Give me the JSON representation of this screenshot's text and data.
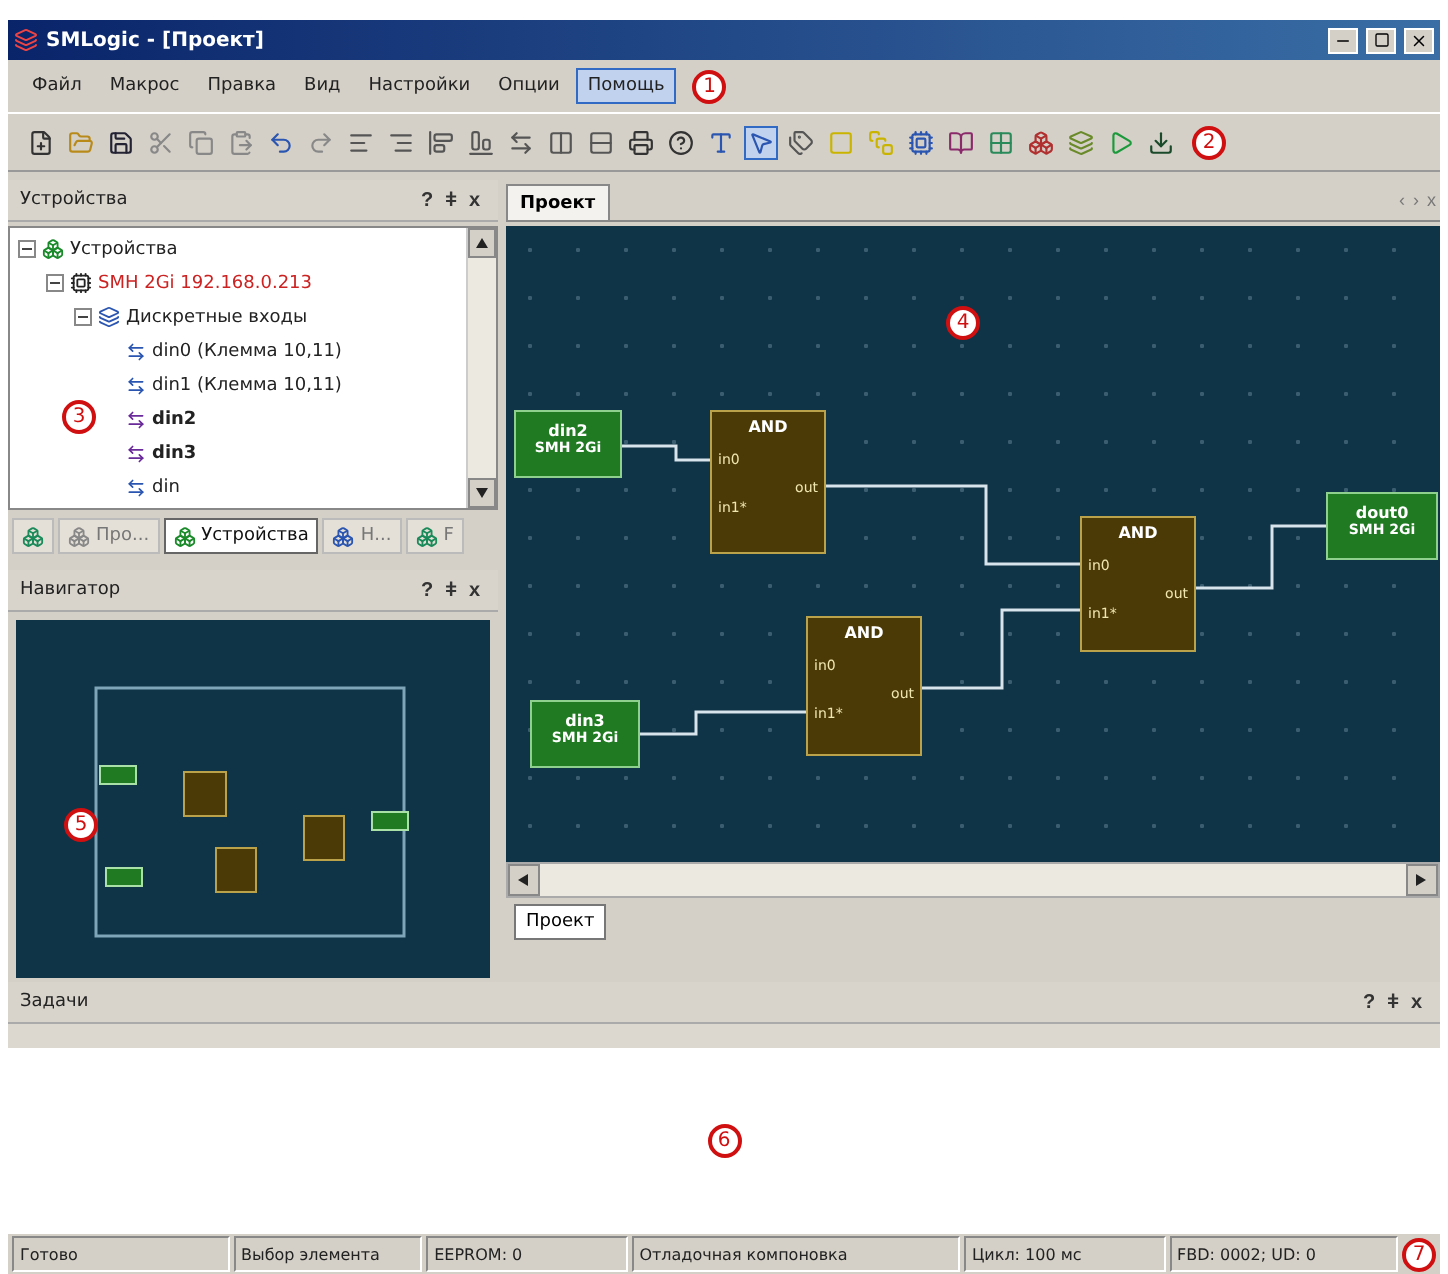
{
  "window": {
    "title": "SMLogic - [Проект]"
  },
  "menu": [
    {
      "label": "Файл",
      "selected": false
    },
    {
      "label": "Макрос",
      "selected": false
    },
    {
      "label": "Правка",
      "selected": false
    },
    {
      "label": "Вид",
      "selected": false
    },
    {
      "label": "Настройки",
      "selected": false
    },
    {
      "label": "Опции",
      "selected": false
    },
    {
      "label": "Помощь",
      "selected": true
    }
  ],
  "devices_panel": {
    "title": "Устройства",
    "controls": [
      "?",
      "ǂ",
      "x"
    ],
    "tree": [
      {
        "label": "Устройства",
        "kind": "root",
        "expanded": true,
        "children": [
          {
            "label": "SMH 2Gi 192.168.0.213",
            "kind": "device",
            "color": "#cc2222",
            "expanded": true,
            "children": [
              {
                "label": "Дискретные входы",
                "kind": "group",
                "expanded": true,
                "children": [
                  {
                    "label": "din0 (Клемма 10,11)",
                    "kind": "input",
                    "bold": false
                  },
                  {
                    "label": "din1 (Клемма 10,11)",
                    "kind": "input",
                    "bold": false
                  },
                  {
                    "label": "din2",
                    "kind": "input",
                    "bold": true
                  },
                  {
                    "label": "din3",
                    "kind": "input",
                    "bold": true
                  },
                  {
                    "label": "din",
                    "kind": "input",
                    "bold": false
                  }
                ]
              }
            ]
          }
        ]
      }
    ],
    "tabs": [
      {
        "selected": false
      },
      {
        "label": "Про...",
        "selected": false
      },
      {
        "label": "Устройства",
        "selected": true
      },
      {
        "label": "Н...",
        "selected": false
      },
      {
        "label": "F",
        "selected": false
      }
    ]
  },
  "navigator": {
    "title": "Навигатор",
    "controls": [
      "?",
      "ǂ",
      "x"
    ]
  },
  "document": {
    "tab": "Проект",
    "nav": [
      "‹",
      "›",
      "x"
    ],
    "bottom_tab": "Проект",
    "blocks": [
      {
        "kind": "input",
        "name": "din2",
        "device": "SMH 2Gi"
      },
      {
        "kind": "gate",
        "title": "AND",
        "inputs": [
          "in0",
          "in1*"
        ],
        "output": "out"
      },
      {
        "kind": "gate",
        "title": "AND",
        "inputs": [
          "in0",
          "in1*"
        ],
        "output": "out"
      },
      {
        "kind": "gate",
        "title": "AND",
        "inputs": [
          "in0",
          "in1*"
        ],
        "output": "out"
      },
      {
        "kind": "input",
        "name": "din3",
        "device": "SMH 2Gi"
      },
      {
        "kind": "output",
        "name": "dout0",
        "device": "SMH 2Gi"
      }
    ]
  },
  "tasks_panel": {
    "title": "Задачи",
    "controls": [
      "?",
      "ǂ",
      "x"
    ]
  },
  "status_bar": [
    "Готово",
    "Выбор элемента",
    "EEPROM: 0",
    "Отладочная компоновка",
    "Цикл: 100 мс",
    "FBD: 0002; UD: 0"
  ],
  "callouts": [
    "1",
    "2",
    "3",
    "4",
    "5",
    "6",
    "7"
  ]
}
